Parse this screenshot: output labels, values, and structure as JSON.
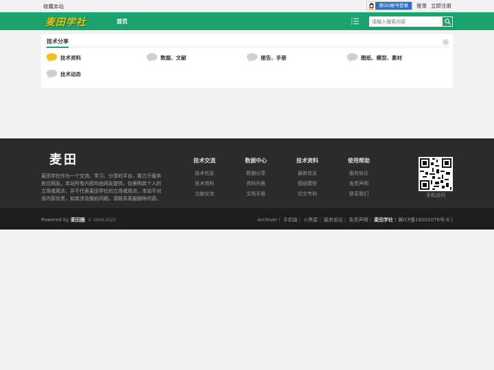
{
  "topbar": {
    "favorite": "收藏本站",
    "qq_login": "用QQ帐号登录",
    "login": "登录",
    "register": "立即注册"
  },
  "header": {
    "logo": "麦田学社",
    "nav_home": "首页",
    "search_placeholder": "请输入搜索内容"
  },
  "panel": {
    "title": "技术分享",
    "categories": [
      {
        "label": "技术资料",
        "bubble_color": "#f2c10b"
      },
      {
        "label": "数据、文献",
        "bubble_color": "#cfcfcf"
      },
      {
        "label": "报告、手册",
        "bubble_color": "#cfcfcf"
      },
      {
        "label": "图纸、模型、素材",
        "bubble_color": "#cfcfcf"
      },
      {
        "label": "技术动态",
        "bubble_color": "#cfcfcf"
      }
    ]
  },
  "footer": {
    "logo": "麦田",
    "description": "麦田学社作为一个交流、学习、分享的平台，致力于服务各位网友。本站所有内容均由网友提供，仅表明其个人的立场或观点，并不代表麦田学社的立场或观点。本站不对该内容负责，如其涉及版权问题，请联系客服删除内容。",
    "columns": [
      {
        "heading": "技术交流",
        "links": [
          "技术信息",
          "技术资料",
          "文献交流"
        ]
      },
      {
        "heading": "数据中心",
        "links": [
          "数据分享",
          "资料列表",
          "文档手册"
        ]
      },
      {
        "heading": "技术资料",
        "links": [
          "最新信息",
          "图纸模型",
          "论文专利"
        ]
      },
      {
        "heading": "使用帮助",
        "links": [
          "服务协议",
          "免责声明",
          "联系我们"
        ]
      }
    ],
    "qr_label": "手机访问"
  },
  "bottom": {
    "powered_prefix": "Powered by",
    "powered_name": "麦田圈",
    "copyright": "© 2009-2023",
    "links": [
      "Archiver",
      "手机版",
      "小黑屋",
      "服务协议",
      "免责声明"
    ],
    "site_name": "麦田学社",
    "icp": "( 冀ICP备16001076号-6 )"
  },
  "colors": {
    "brand_green": "#1aa36c",
    "logo_gold": "#f2c10b",
    "footer_bg": "#2b2b2b"
  }
}
